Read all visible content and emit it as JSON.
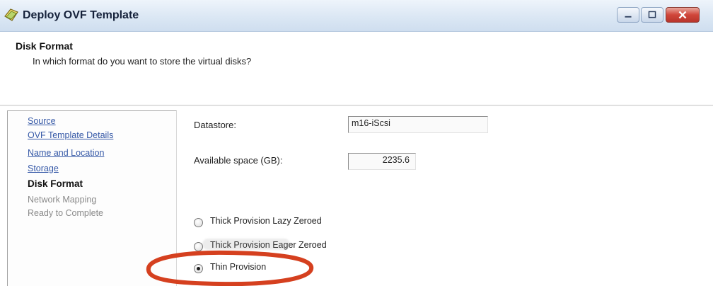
{
  "window": {
    "title": "Deploy OVF Template",
    "icon": "ovf-template-icon",
    "controls": [
      "minimize-icon",
      "maximize-icon",
      "close-icon"
    ],
    "close_color": "#c83b30"
  },
  "header": {
    "title": "Disk Format",
    "subtitle": "In which format do you want to store the virtual disks?"
  },
  "nav": {
    "items": [
      {
        "label": "Source",
        "state": "link"
      },
      {
        "label": "OVF Template Details",
        "state": "link"
      },
      {
        "label": "Name and Location",
        "state": "link"
      },
      {
        "label": "Storage",
        "state": "link"
      },
      {
        "label": "Disk Format",
        "state": "current"
      },
      {
        "label": "Network Mapping",
        "state": "disabled"
      },
      {
        "label": "Ready to Complete",
        "state": "disabled"
      }
    ],
    "link_color": "#3659a7"
  },
  "form": {
    "datastore_label": "Datastore:",
    "datastore_value": "m16-iScsi",
    "space_label": "Available space (GB):",
    "space_value": "2235.6"
  },
  "disk_format": {
    "options": [
      {
        "label": "Thick Provision Lazy Zeroed",
        "selected": false
      },
      {
        "label": "Thick Provision Eager Zeroed",
        "selected": false
      },
      {
        "label": "Thin Provision",
        "selected": true
      }
    ],
    "annotation_color": "#d5401f"
  }
}
